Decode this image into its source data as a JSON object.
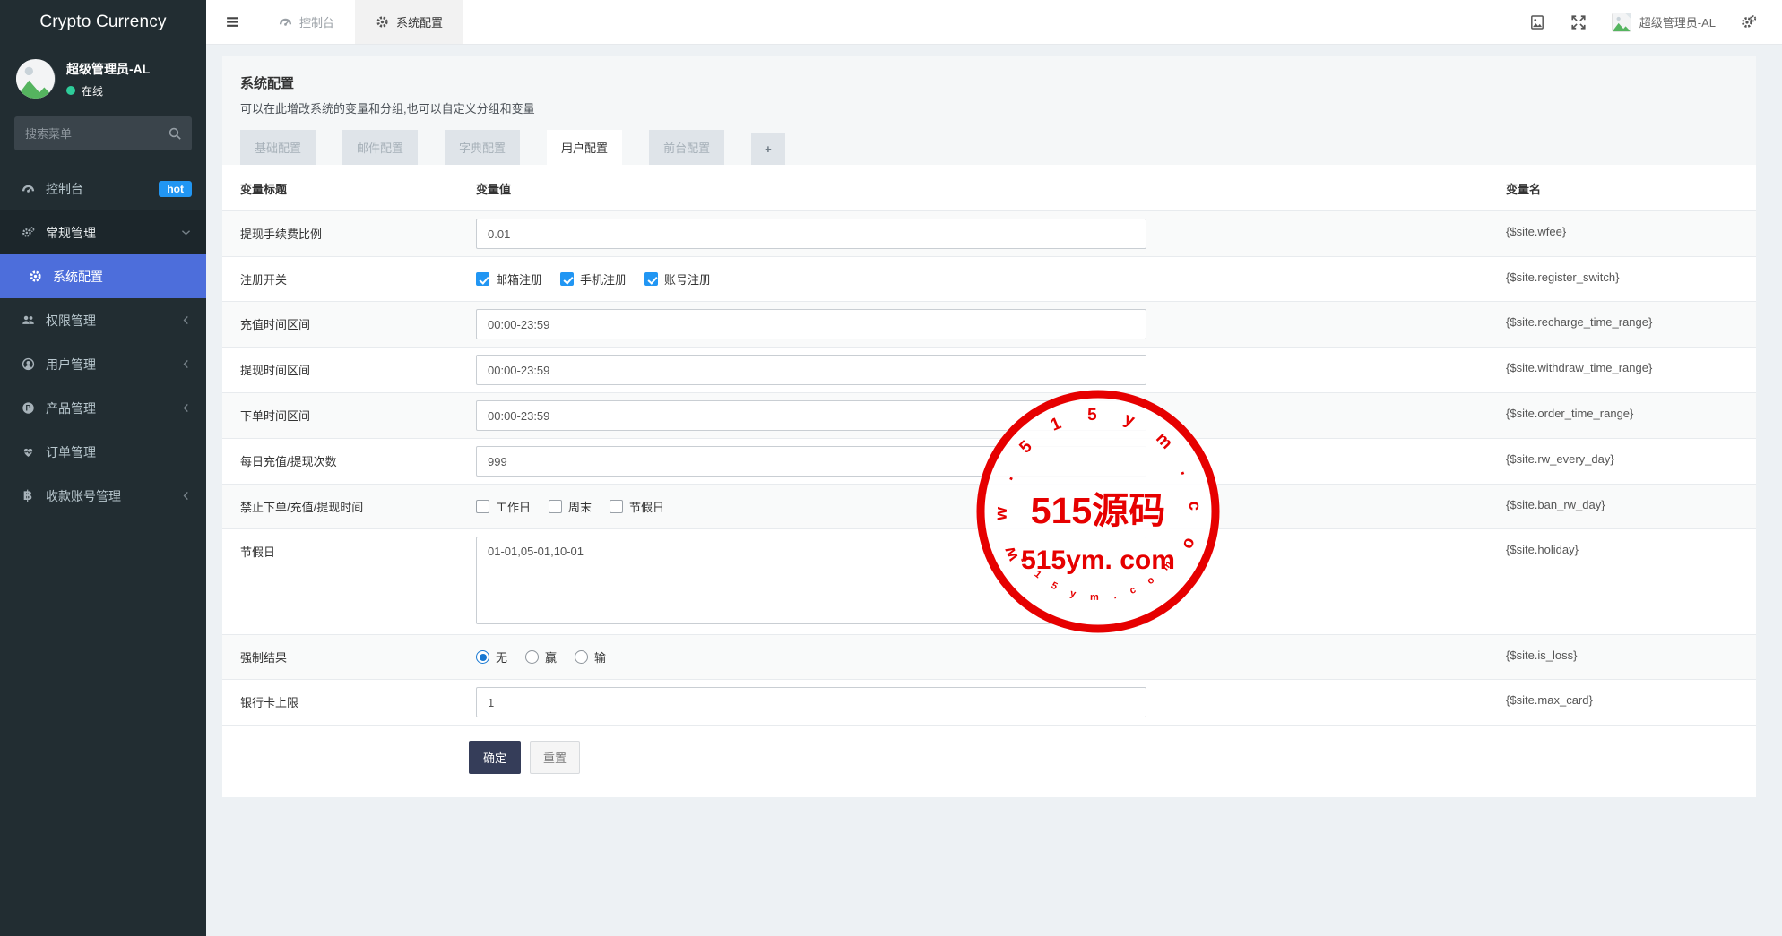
{
  "app": {
    "title": "Crypto Currency"
  },
  "colors": {
    "accent": "#4d6edb",
    "hot_badge": "#2196f3",
    "online_green": "#2ecc9a",
    "stamp_red": "#e60000",
    "submit_button": "#353d59"
  },
  "sidebar": {
    "user": {
      "name": "超级管理员-AL",
      "status": "在线"
    },
    "search_placeholder": "搜索菜单",
    "items": [
      {
        "label": "控制台",
        "icon": "dashboard-icon",
        "badge": "hot"
      },
      {
        "label": "常规管理",
        "icon": "cogs-icon",
        "expanded": true,
        "children": [
          {
            "label": "系统配置",
            "icon": "gear-icon",
            "active": true
          }
        ]
      },
      {
        "label": "权限管理",
        "icon": "users-icon",
        "chevron": true
      },
      {
        "label": "用户管理",
        "icon": "user-icon",
        "chevron": true
      },
      {
        "label": "产品管理",
        "icon": "product-icon",
        "chevron": true
      },
      {
        "label": "订单管理",
        "icon": "orders-icon"
      },
      {
        "label": "收款账号管理",
        "icon": "bitcoin-icon",
        "chevron": true
      }
    ]
  },
  "topbar": {
    "tabs": [
      {
        "label": "控制台",
        "icon": "dashboard-icon",
        "active": false
      },
      {
        "label": "系统配置",
        "icon": "gear-icon",
        "active": true
      }
    ],
    "user_name": "超级管理员-AL"
  },
  "page": {
    "title": "系统配置",
    "subtitle": "可以在此增改系统的变量和分组,也可以自定义分组和变量",
    "tabs": [
      {
        "label": "基础配置",
        "active": false
      },
      {
        "label": "邮件配置",
        "active": false
      },
      {
        "label": "字典配置",
        "active": false
      },
      {
        "label": "用户配置",
        "active": true
      },
      {
        "label": "前台配置",
        "active": false
      }
    ],
    "add_tab_label": "+"
  },
  "table": {
    "headers": {
      "title": "变量标题",
      "value": "变量值",
      "var": "变量名"
    },
    "rows": [
      {
        "title": "提现手续费比例",
        "type": "input",
        "value": "0.01",
        "var": "{$site.wfee}"
      },
      {
        "title": "注册开关",
        "type": "checkboxes",
        "var": "{$site.register_switch}",
        "options": [
          {
            "label": "邮箱注册",
            "checked": true
          },
          {
            "label": "手机注册",
            "checked": true
          },
          {
            "label": "账号注册",
            "checked": true
          }
        ]
      },
      {
        "title": "充值时间区间",
        "type": "input",
        "value": "00:00-23:59",
        "var": "{$site.recharge_time_range}"
      },
      {
        "title": "提现时间区间",
        "type": "input",
        "value": "00:00-23:59",
        "var": "{$site.withdraw_time_range}"
      },
      {
        "title": "下单时间区间",
        "type": "input",
        "value": "00:00-23:59",
        "var": "{$site.order_time_range}"
      },
      {
        "title": "每日充值/提现次数",
        "type": "input",
        "value": "999",
        "var": "{$site.rw_every_day}"
      },
      {
        "title": "禁止下单/充值/提现时间",
        "type": "checkboxes",
        "var": "{$site.ban_rw_day}",
        "options": [
          {
            "label": "工作日",
            "checked": false
          },
          {
            "label": "周末",
            "checked": false
          },
          {
            "label": "节假日",
            "checked": false
          }
        ]
      },
      {
        "title": "节假日",
        "type": "textarea",
        "value": "01-01,05-01,10-01",
        "var": "{$site.holiday}"
      },
      {
        "title": "强制结果",
        "type": "radios",
        "var": "{$site.is_loss}",
        "options": [
          {
            "label": "无",
            "checked": true
          },
          {
            "label": "赢",
            "checked": false
          },
          {
            "label": "输",
            "checked": false
          }
        ]
      },
      {
        "title": "银行卡上限",
        "type": "input",
        "value": "1",
        "var": "{$site.max_card}"
      }
    ]
  },
  "actions": {
    "submit_label": "确定",
    "reset_label": "重置"
  },
  "watermark": {
    "arc_top": "w w w . 5 1 5 y m . c o m",
    "center_main": "515源码",
    "center_sub": "515ym. com",
    "arc_bottom": "5 1 5 y m . c o m"
  }
}
